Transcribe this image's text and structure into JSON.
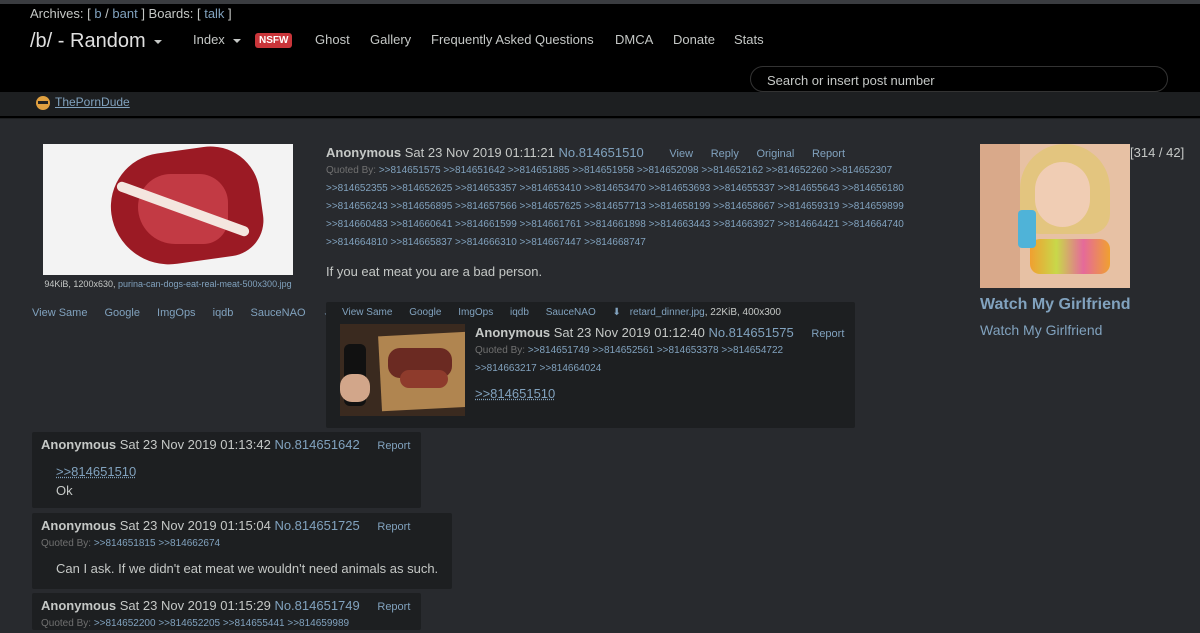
{
  "header": {
    "archives_label": "Archives:",
    "archives_links": [
      "b",
      "bant"
    ],
    "boards_label": "Boards:",
    "boards_links": [
      "talk"
    ],
    "board_title": "/b/ - Random",
    "nav": {
      "index": "Index",
      "nsfw": "NSFW",
      "ghost": "Ghost",
      "gallery": "Gallery",
      "faq": "Frequently Asked Questions",
      "dmca": "DMCA",
      "donate": "Donate",
      "stats": "Stats"
    },
    "search_placeholder": "Search or insert post number"
  },
  "adbar": {
    "link": "ThePornDude"
  },
  "op": {
    "file_info": "94KiB, 1200x630,",
    "filename": "purina-can-dogs-eat-real-meat-500x300.jpg",
    "tools": [
      "View Same",
      "Google",
      "ImgOps",
      "iqdb",
      "SauceNAO"
    ],
    "name": "Anonymous",
    "date": "Sat 23 Nov 2019 01:11:21",
    "postno": "No.814651510",
    "controls": [
      "View",
      "Reply",
      "Original",
      "Report"
    ],
    "quoted_label": "Quoted By:",
    "quoted": [
      ">>814651575",
      ">>814651642",
      ">>814651885",
      ">>814651958",
      ">>814652098",
      ">>814652162",
      ">>814652260",
      ">>814652307",
      ">>814652355",
      ">>814652625",
      ">>814653357",
      ">>814653410",
      ">>814653470",
      ">>814653693",
      ">>814655337",
      ">>814655643",
      ">>814656180",
      ">>814656243",
      ">>814656895",
      ">>814657566",
      ">>814657625",
      ">>814657713",
      ">>814658199",
      ">>814658667",
      ">>814659319",
      ">>814659899",
      ">>814660483",
      ">>814660641",
      ">>814661599",
      ">>814661761",
      ">>814661898",
      ">>814663443",
      ">>814663927",
      ">>814664421",
      ">>814664740",
      ">>814664810",
      ">>814665837",
      ">>814666310",
      ">>814667447",
      ">>814668747"
    ],
    "body": "If you eat meat you are a bad person."
  },
  "replies": [
    {
      "tools": [
        "View Same",
        "Google",
        "ImgOps",
        "iqdb",
        "SauceNAO"
      ],
      "filename": "retard_dinner.jpg",
      "file_info": ", 22KiB, 400x300",
      "name": "Anonymous",
      "date": "Sat 23 Nov 2019 01:12:40",
      "postno": "No.814651575",
      "report": "Report",
      "quoted_label": "Quoted By:",
      "quoted_line1": [
        ">>814651749",
        ">>814652561",
        ">>814653378",
        ">>814654722"
      ],
      "quoted_line2": [
        ">>814663217",
        ">>814664024"
      ],
      "quotelink": ">>814651510"
    },
    {
      "name": "Anonymous",
      "date": "Sat 23 Nov 2019 01:13:42",
      "postno": "No.814651642",
      "report": "Report",
      "quotelink": ">>814651510",
      "body": "Ok"
    },
    {
      "name": "Anonymous",
      "date": "Sat 23 Nov 2019 01:15:04",
      "postno": "No.814651725",
      "report": "Report",
      "quoted_label": "Quoted By:",
      "quoted": [
        ">>814651815",
        ">>814662674"
      ],
      "body": "Can I ask. If we didn't eat meat we wouldn't need animals as such."
    },
    {
      "name": "Anonymous",
      "date": "Sat 23 Nov 2019 01:15:29",
      "postno": "No.814651749",
      "report": "Report",
      "quoted_label": "Quoted By:",
      "quoted": [
        ">>814652200",
        ">>814652205",
        ">>814655441",
        ">>814659989"
      ]
    }
  ],
  "sidebar": {
    "counter": "[314 / 42]",
    "ad_title": "Watch My Girlfriend",
    "ad_sub": "Watch My Girlfriend"
  },
  "colors": {
    "background": "#282a2e",
    "post": "#1d1f21",
    "link": "#81a2be",
    "nsfw": "#c9353a"
  }
}
